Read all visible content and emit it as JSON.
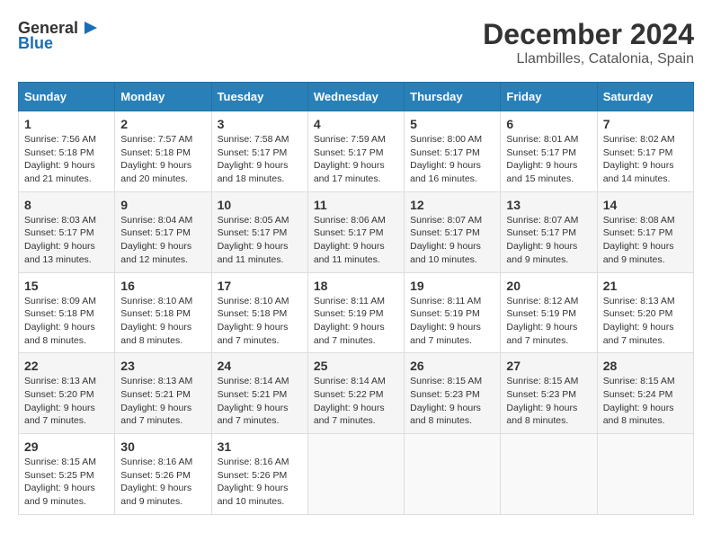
{
  "header": {
    "logo_text_general": "General",
    "logo_text_blue": "Blue",
    "month_year": "December 2024",
    "location": "Llambilles, Catalonia, Spain"
  },
  "days_of_week": [
    "Sunday",
    "Monday",
    "Tuesday",
    "Wednesday",
    "Thursday",
    "Friday",
    "Saturday"
  ],
  "weeks": [
    [
      {
        "day": "1",
        "sunrise": "7:56 AM",
        "sunset": "5:18 PM",
        "daylight": "9 hours and 21 minutes."
      },
      {
        "day": "2",
        "sunrise": "7:57 AM",
        "sunset": "5:18 PM",
        "daylight": "9 hours and 20 minutes."
      },
      {
        "day": "3",
        "sunrise": "7:58 AM",
        "sunset": "5:17 PM",
        "daylight": "9 hours and 18 minutes."
      },
      {
        "day": "4",
        "sunrise": "7:59 AM",
        "sunset": "5:17 PM",
        "daylight": "9 hours and 17 minutes."
      },
      {
        "day": "5",
        "sunrise": "8:00 AM",
        "sunset": "5:17 PM",
        "daylight": "9 hours and 16 minutes."
      },
      {
        "day": "6",
        "sunrise": "8:01 AM",
        "sunset": "5:17 PM",
        "daylight": "9 hours and 15 minutes."
      },
      {
        "day": "7",
        "sunrise": "8:02 AM",
        "sunset": "5:17 PM",
        "daylight": "9 hours and 14 minutes."
      }
    ],
    [
      {
        "day": "8",
        "sunrise": "8:03 AM",
        "sunset": "5:17 PM",
        "daylight": "9 hours and 13 minutes."
      },
      {
        "day": "9",
        "sunrise": "8:04 AM",
        "sunset": "5:17 PM",
        "daylight": "9 hours and 12 minutes."
      },
      {
        "day": "10",
        "sunrise": "8:05 AM",
        "sunset": "5:17 PM",
        "daylight": "9 hours and 11 minutes."
      },
      {
        "day": "11",
        "sunrise": "8:06 AM",
        "sunset": "5:17 PM",
        "daylight": "9 hours and 11 minutes."
      },
      {
        "day": "12",
        "sunrise": "8:07 AM",
        "sunset": "5:17 PM",
        "daylight": "9 hours and 10 minutes."
      },
      {
        "day": "13",
        "sunrise": "8:07 AM",
        "sunset": "5:17 PM",
        "daylight": "9 hours and 9 minutes."
      },
      {
        "day": "14",
        "sunrise": "8:08 AM",
        "sunset": "5:17 PM",
        "daylight": "9 hours and 9 minutes."
      }
    ],
    [
      {
        "day": "15",
        "sunrise": "8:09 AM",
        "sunset": "5:18 PM",
        "daylight": "9 hours and 8 minutes."
      },
      {
        "day": "16",
        "sunrise": "8:10 AM",
        "sunset": "5:18 PM",
        "daylight": "9 hours and 8 minutes."
      },
      {
        "day": "17",
        "sunrise": "8:10 AM",
        "sunset": "5:18 PM",
        "daylight": "9 hours and 7 minutes."
      },
      {
        "day": "18",
        "sunrise": "8:11 AM",
        "sunset": "5:19 PM",
        "daylight": "9 hours and 7 minutes."
      },
      {
        "day": "19",
        "sunrise": "8:11 AM",
        "sunset": "5:19 PM",
        "daylight": "9 hours and 7 minutes."
      },
      {
        "day": "20",
        "sunrise": "8:12 AM",
        "sunset": "5:19 PM",
        "daylight": "9 hours and 7 minutes."
      },
      {
        "day": "21",
        "sunrise": "8:13 AM",
        "sunset": "5:20 PM",
        "daylight": "9 hours and 7 minutes."
      }
    ],
    [
      {
        "day": "22",
        "sunrise": "8:13 AM",
        "sunset": "5:20 PM",
        "daylight": "9 hours and 7 minutes."
      },
      {
        "day": "23",
        "sunrise": "8:13 AM",
        "sunset": "5:21 PM",
        "daylight": "9 hours and 7 minutes."
      },
      {
        "day": "24",
        "sunrise": "8:14 AM",
        "sunset": "5:21 PM",
        "daylight": "9 hours and 7 minutes."
      },
      {
        "day": "25",
        "sunrise": "8:14 AM",
        "sunset": "5:22 PM",
        "daylight": "9 hours and 7 minutes."
      },
      {
        "day": "26",
        "sunrise": "8:15 AM",
        "sunset": "5:23 PM",
        "daylight": "9 hours and 8 minutes."
      },
      {
        "day": "27",
        "sunrise": "8:15 AM",
        "sunset": "5:23 PM",
        "daylight": "9 hours and 8 minutes."
      },
      {
        "day": "28",
        "sunrise": "8:15 AM",
        "sunset": "5:24 PM",
        "daylight": "9 hours and 8 minutes."
      }
    ],
    [
      {
        "day": "29",
        "sunrise": "8:15 AM",
        "sunset": "5:25 PM",
        "daylight": "9 hours and 9 minutes."
      },
      {
        "day": "30",
        "sunrise": "8:16 AM",
        "sunset": "5:26 PM",
        "daylight": "9 hours and 9 minutes."
      },
      {
        "day": "31",
        "sunrise": "8:16 AM",
        "sunset": "5:26 PM",
        "daylight": "9 hours and 10 minutes."
      },
      null,
      null,
      null,
      null
    ]
  ]
}
